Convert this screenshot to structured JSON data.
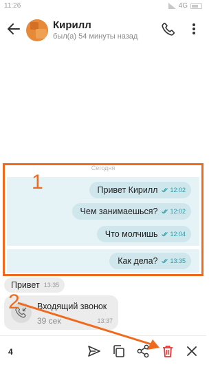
{
  "status_bar": {
    "time": "11:26",
    "network": "4G"
  },
  "header": {
    "contact_name": "Кирилл",
    "last_seen": "был(а) 54 минуты назад",
    "icons": [
      "back-arrow-icon",
      "phone-icon",
      "more-vert-icon"
    ]
  },
  "date_separator": "Сегодня",
  "outgoing_messages": [
    {
      "text": "Привет Кирилл",
      "time": "12:02"
    },
    {
      "text": "Чем занимаешься?",
      "time": "12:02"
    },
    {
      "text": "Что молчишь",
      "time": "12:04"
    },
    {
      "text": "Как дела?",
      "time": "13:35"
    }
  ],
  "incoming_message": {
    "text": "Привет",
    "time": "13:35"
  },
  "incoming_call": {
    "title": "Входящий звонок",
    "duration": "39 сек",
    "time": "13:37"
  },
  "annotations": {
    "box_label": "1",
    "arrow_label": "2",
    "color": "#ee6a1d"
  },
  "action_bar": {
    "selected_count": "4",
    "icons": [
      "send-icon",
      "copy-icon",
      "share-icon",
      "delete-icon",
      "close-icon"
    ],
    "delete_color": "#e53935"
  },
  "colors": {
    "selection_bg": "#e6f3f6",
    "outgoing_bubble": "#cfe6ec",
    "check_color": "#2a9ca6"
  }
}
